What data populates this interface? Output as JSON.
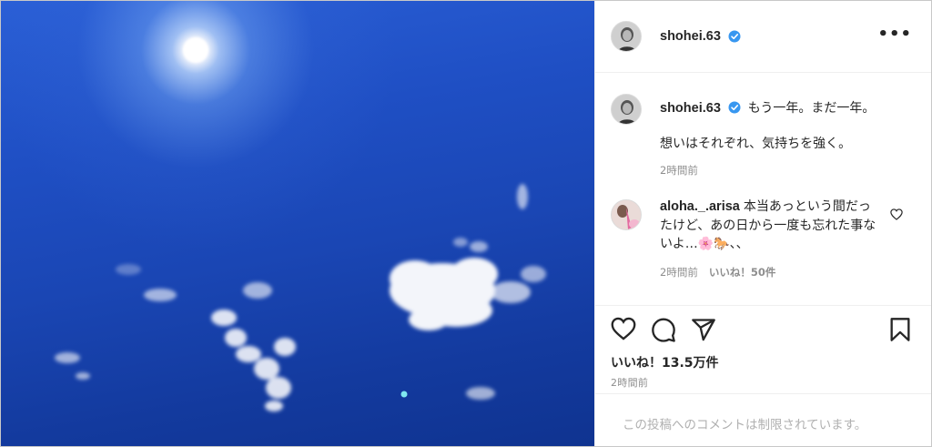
{
  "post": {
    "author": "shohei.63",
    "verified": true,
    "more_label": "•••",
    "photo_desc_icon": "photo-sky-sun-clouds"
  },
  "caption": {
    "username": "shohei.63",
    "line1": "もう一年。まだ一年。",
    "line2": "想いはそれぞれ、気持ちを強く。",
    "time": "2時間前"
  },
  "comment": {
    "username": "aloha._.arisa",
    "text": "本当あっという間だったけど、あの日から一度も忘れた事ないよ…🌸🐎、、",
    "time": "2時間前",
    "likes": "いいね！50件"
  },
  "actions": {
    "likes_total": "いいね！13.5万件",
    "post_time": "2時間前"
  },
  "comment_box": {
    "disabled_text": "この投稿へのコメントは制限されています。"
  },
  "colors": {
    "verified_blue": "#3897f0",
    "sky_blue": "#1f4fc4",
    "muted_text": "#8e8e8e"
  }
}
